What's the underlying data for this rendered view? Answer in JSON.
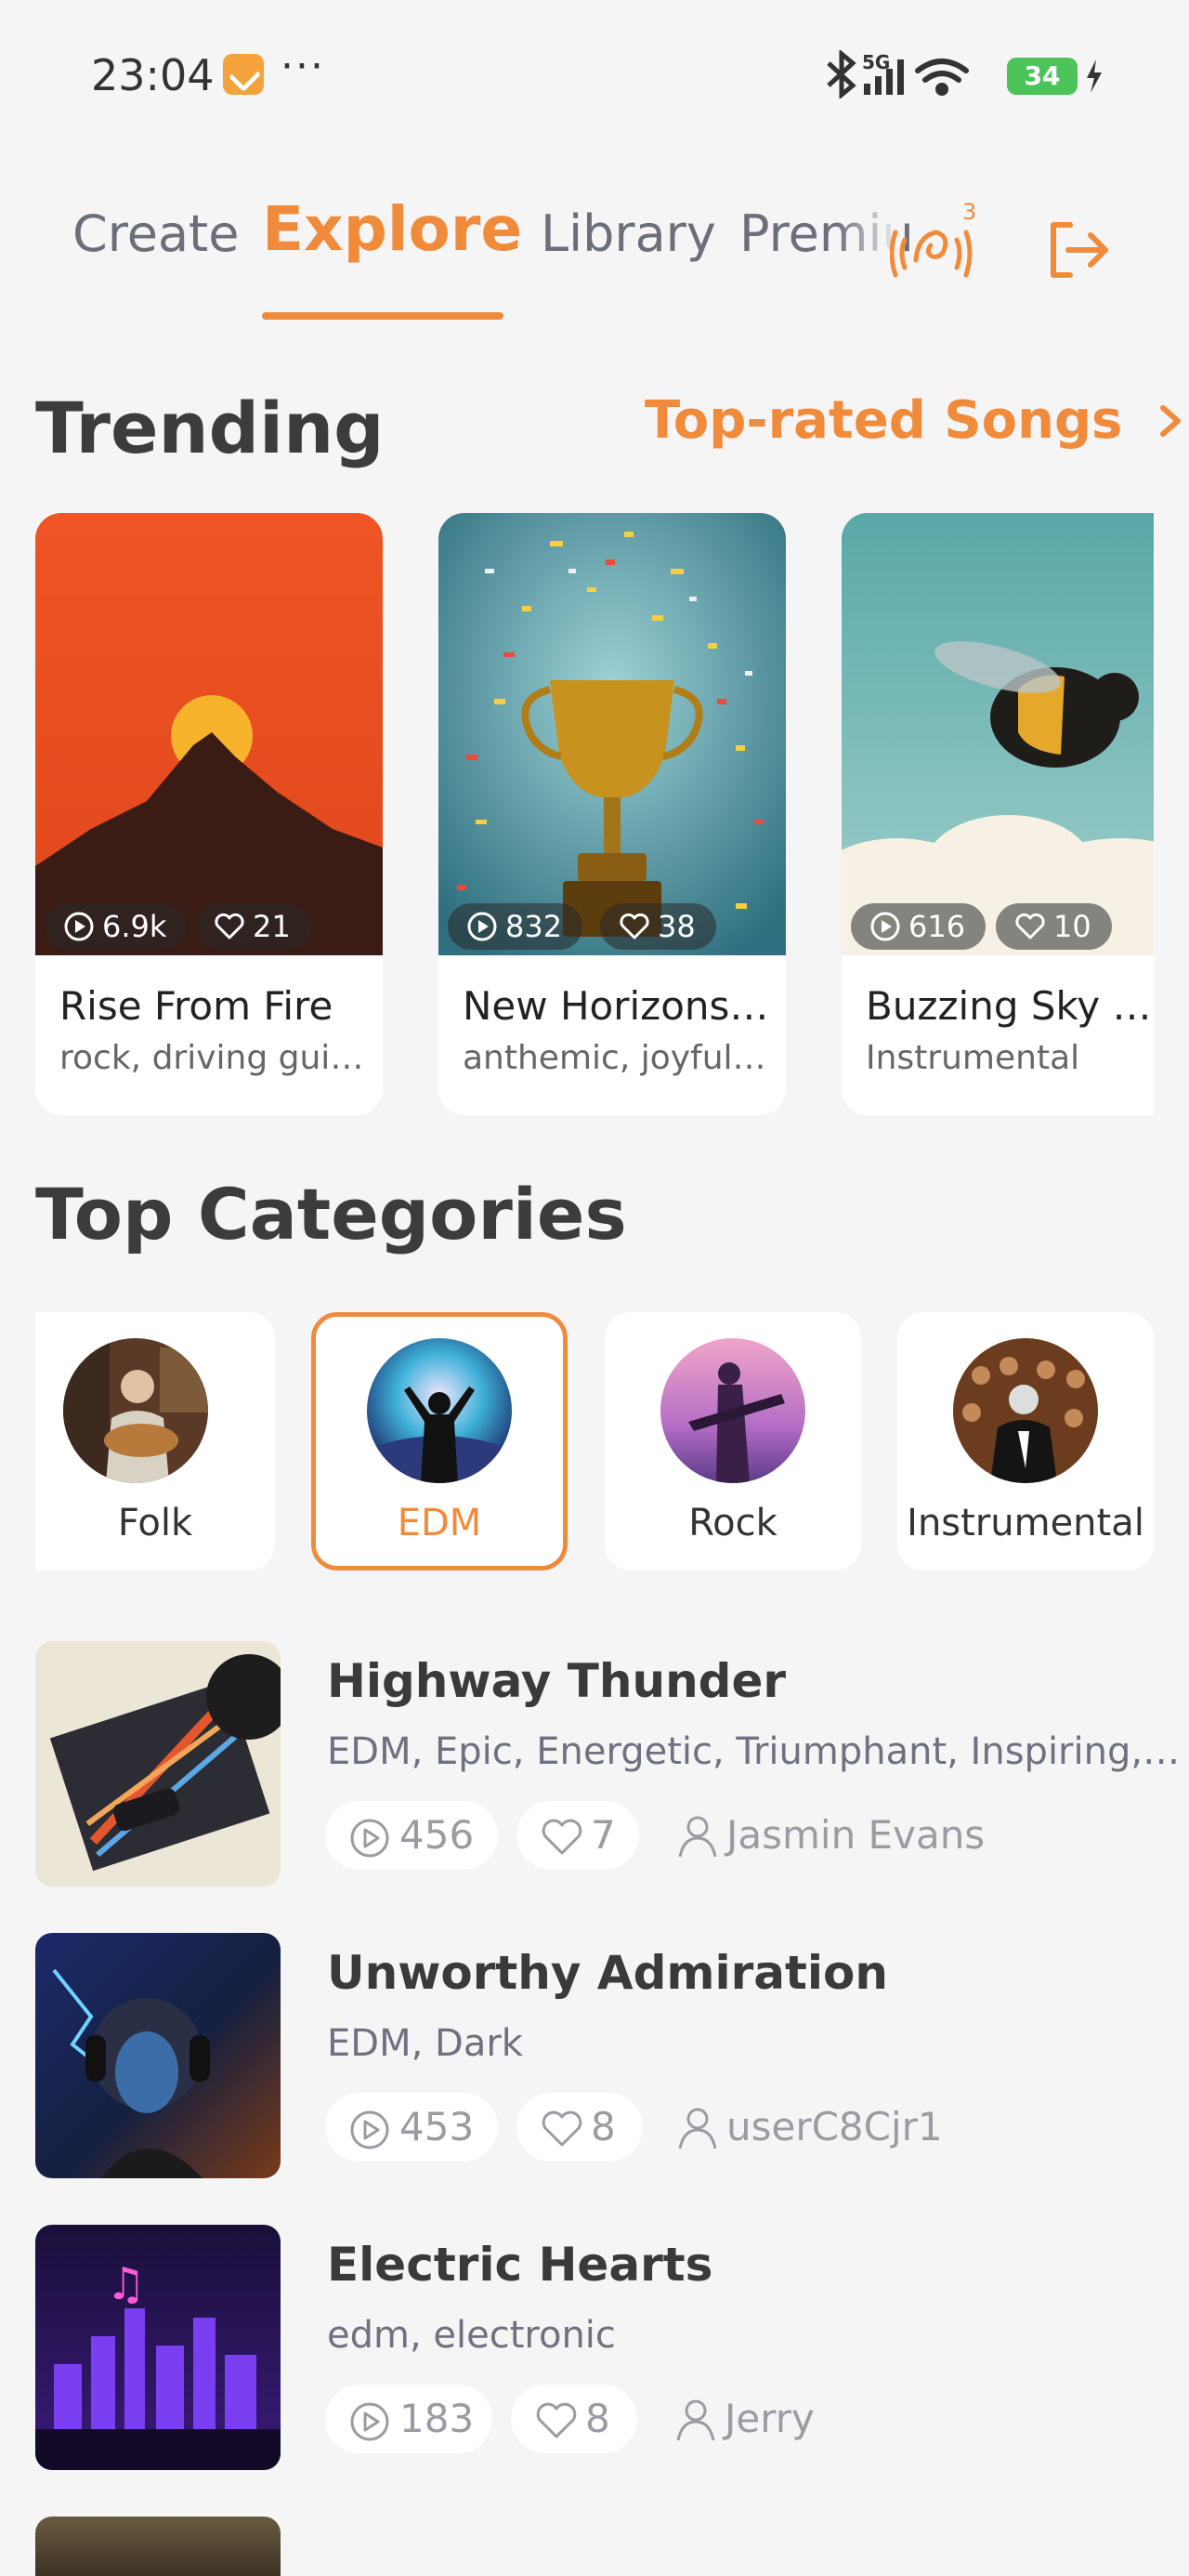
{
  "status_bar": {
    "time": "23:04",
    "dots": "···",
    "network": "5G",
    "battery": "34"
  },
  "tabs": [
    {
      "label": "Create",
      "active": false
    },
    {
      "label": "Explore",
      "active": true
    },
    {
      "label": "Library",
      "active": false
    },
    {
      "label": "Premiu",
      "active": false
    }
  ],
  "header": {
    "notification_count": "3"
  },
  "trending": {
    "title": "Trending",
    "link": "Top-rated Songs",
    "cards": [
      {
        "title": "Rise From Fire",
        "subtitle": "rock, driving guitar",
        "plays": "6.9k",
        "likes": "21"
      },
      {
        "title": "New Horizons Anthem",
        "subtitle": "anthemic, joyful, uplifting",
        "plays": "832",
        "likes": "38"
      },
      {
        "title": "Buzzing Sky Symphony",
        "subtitle": "Instrumental",
        "plays": "616",
        "likes": "10"
      }
    ]
  },
  "categories": {
    "title": "Top Categories",
    "items": [
      {
        "label": "Folk",
        "selected": false
      },
      {
        "label": "EDM",
        "selected": true
      },
      {
        "label": "Rock",
        "selected": false
      },
      {
        "label": "Instrumental",
        "selected": false
      }
    ]
  },
  "songs": [
    {
      "title": "Highway Thunder",
      "tags": "EDM, Epic, Energetic, Triumphant, Inspiring, Powerful",
      "plays": "456",
      "likes": "7",
      "user": "Jasmin Evans"
    },
    {
      "title": "Unworthy Admiration",
      "tags": "EDM, Dark",
      "plays": "453",
      "likes": "8",
      "user": "userC8Cjr1"
    },
    {
      "title": "Electric Hearts",
      "tags": "edm, electronic",
      "plays": "183",
      "likes": "8",
      "user": "Jerry"
    }
  ],
  "colors": {
    "accent": "#f08b3c",
    "background": "#f5f5f6"
  }
}
